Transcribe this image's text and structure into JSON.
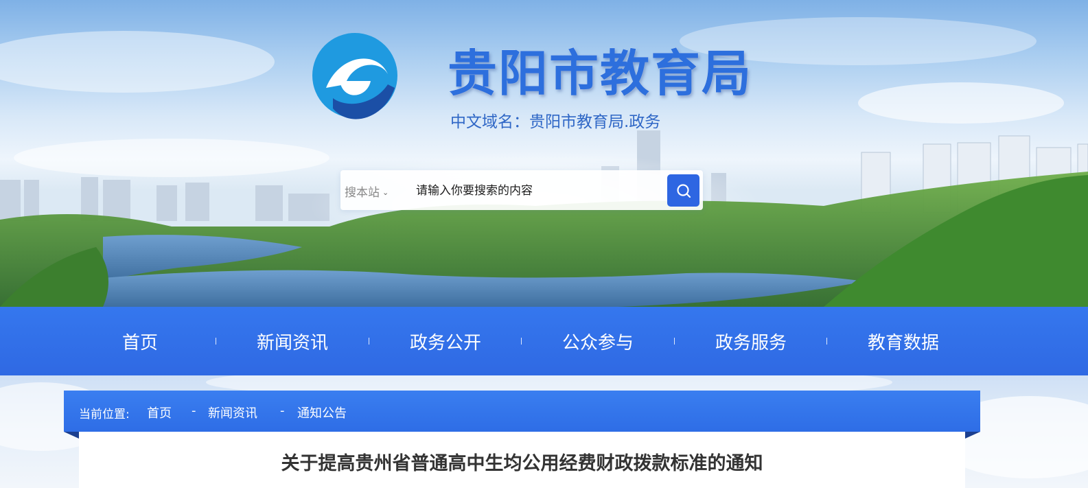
{
  "header": {
    "site_title": "贵阳市教育局",
    "domain_line": "中文域名：贵阳市教育局.政务"
  },
  "search": {
    "scope_label": "搜本站",
    "placeholder": "请输入你要搜索的内容",
    "button_icon": "search-icon"
  },
  "nav": {
    "items": [
      {
        "label": "首页"
      },
      {
        "label": "新闻资讯"
      },
      {
        "label": "政务公开"
      },
      {
        "label": "公众参与"
      },
      {
        "label": "政务服务"
      },
      {
        "label": "教育数据"
      }
    ]
  },
  "breadcrumb": {
    "label": "当前位置:",
    "items": [
      "首页",
      "新闻资讯",
      "通知公告"
    ],
    "separator": "-"
  },
  "article": {
    "title": "关于提高贵州省普通高中生均公用经费财政拨款标准的通知"
  },
  "colors": {
    "brand_blue": "#2e66e2",
    "title_blue": "#2d6fdd",
    "article_title": "#333333"
  }
}
